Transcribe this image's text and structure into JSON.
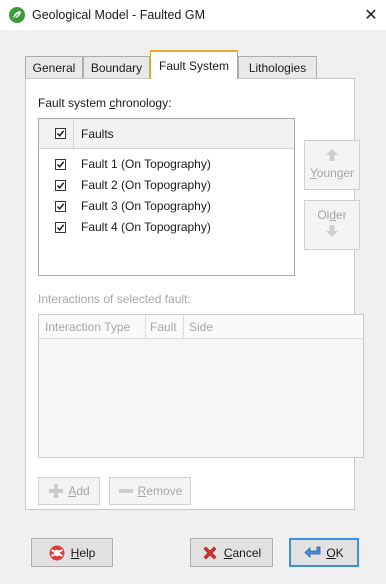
{
  "window": {
    "title": "Geological Model - Faulted GM",
    "close_glyph": "✕"
  },
  "tabs": [
    {
      "label": "General"
    },
    {
      "label": "Boundary"
    },
    {
      "label": "Fault System",
      "active": true
    },
    {
      "label": "Lithologies"
    }
  ],
  "fault_system": {
    "chronology_label_pre": "Fault system ",
    "chronology_label_key": "c",
    "chronology_label_post": "hronology:",
    "header_label": "Faults",
    "header_checked": true,
    "faults": [
      {
        "label": "Fault 1 (On Topography)",
        "checked": true
      },
      {
        "label": "Fault 2 (On Topography)",
        "checked": true
      },
      {
        "label": "Fault 3 (On Topography)",
        "checked": true
      },
      {
        "label": "Fault 4 (On Topography)",
        "checked": true
      }
    ],
    "younger_key": "Y",
    "younger_rest": "ounger",
    "older_pre": "Ol",
    "older_key": "d",
    "older_post": "er"
  },
  "interactions": {
    "label": "Interactions of selected fault:",
    "columns": [
      "Interaction Type",
      "Fault",
      "Side"
    ],
    "add_key": "A",
    "add_rest": "dd",
    "remove_key": "R",
    "remove_rest": "emove"
  },
  "footer": {
    "help_key": "H",
    "help_rest": "elp",
    "cancel_key": "C",
    "cancel_rest": "ancel",
    "ok_key": "O",
    "ok_rest": "K"
  },
  "icons": {
    "app": "leaf-icon",
    "up_arrow": "arrow-up-icon",
    "down_arrow": "arrow-down-icon",
    "add": "plus-icon",
    "remove": "minus-icon",
    "help": "help-icon",
    "cancel": "cancel-x-icon",
    "ok": "ok-arrow-icon"
  },
  "colors": {
    "active_tab_accent": "#f0a830",
    "primary_button_border": "#3c8fdf",
    "disabled_text": "#a6a6a6"
  }
}
